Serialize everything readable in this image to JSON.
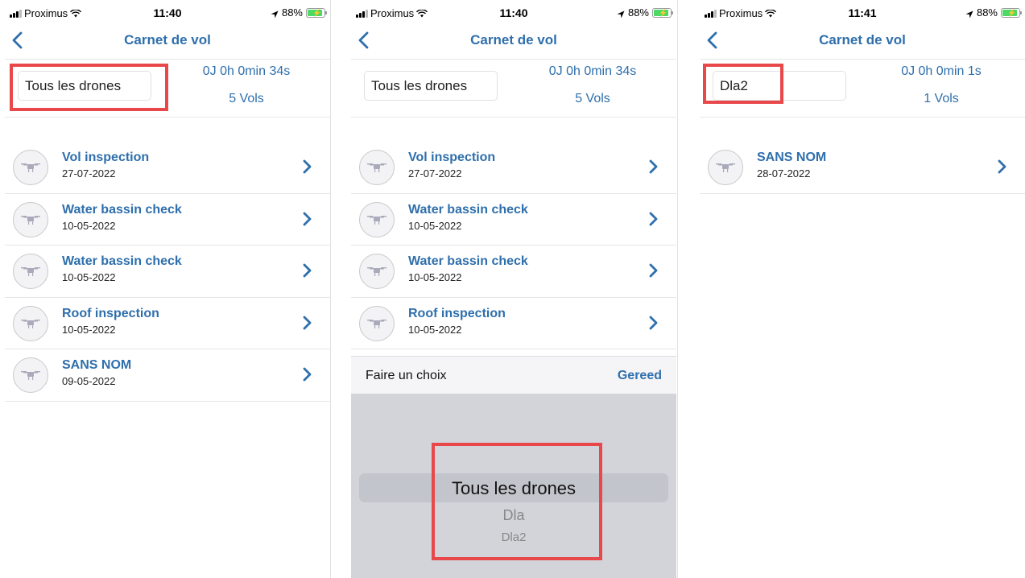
{
  "status_bar": {
    "carrier": "Proximus",
    "battery": "88%"
  },
  "screens": [
    {
      "time": "11:40",
      "nav_title": "Carnet de vol",
      "drone_filter": "Tous les drones",
      "total_duration": "0J 0h 0min 34s",
      "flight_count": "5 Vols",
      "flights": [
        {
          "name": "Vol inspection",
          "date": "27-07-2022"
        },
        {
          "name": "Water bassin check",
          "date": "10-05-2022"
        },
        {
          "name": "Water bassin check",
          "date": "10-05-2022"
        },
        {
          "name": "Roof inspection",
          "date": "10-05-2022"
        },
        {
          "name": "SANS NOM",
          "date": "09-05-2022"
        }
      ]
    },
    {
      "time": "11:40",
      "nav_title": "Carnet de vol",
      "drone_filter": "Tous les drones",
      "total_duration": "0J 0h 0min 34s",
      "flight_count": "5 Vols",
      "flights": [
        {
          "name": "Vol inspection",
          "date": "27-07-2022"
        },
        {
          "name": "Water bassin check",
          "date": "10-05-2022"
        },
        {
          "name": "Water bassin check",
          "date": "10-05-2022"
        },
        {
          "name": "Roof inspection",
          "date": "10-05-2022"
        }
      ],
      "picker": {
        "title": "Faire un choix",
        "done_label": "Gereed",
        "options": [
          "Tous les drones",
          "Dla",
          "Dla2"
        ],
        "selected": "Tous les drones"
      }
    },
    {
      "time": "11:41",
      "nav_title": "Carnet de vol",
      "drone_filter": "Dla2",
      "total_duration": "0J 0h 0min 1s",
      "flight_count": "1 Vols",
      "flights": [
        {
          "name": "SANS NOM",
          "date": "28-07-2022"
        }
      ]
    }
  ],
  "colors": {
    "accent": "#2e6fac",
    "highlight": "#e8484a",
    "picker_bg": "#d2d4da"
  },
  "icons": [
    "signal-icon",
    "wifi-icon",
    "location-arrow-icon",
    "battery-icon",
    "back-chevron-icon",
    "drone-icon",
    "chevron-right-icon"
  ]
}
